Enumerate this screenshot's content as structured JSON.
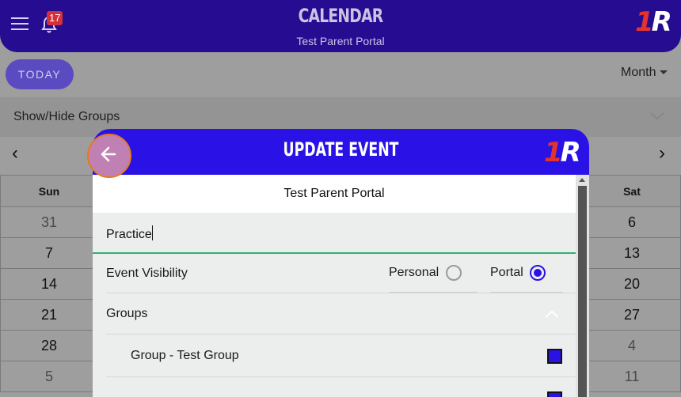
{
  "header": {
    "title": "CALENDAR",
    "subtitle": "Test Parent Portal",
    "notification_count": "17",
    "logo": "1R"
  },
  "toolbar": {
    "today_label": "TODAY",
    "view_label": "Month"
  },
  "groups_bar": {
    "label": "Show/Hide Groups"
  },
  "calendar": {
    "days": [
      "Sun",
      "Sat"
    ],
    "weeks": [
      [
        "31",
        "6"
      ],
      [
        "7",
        "13"
      ],
      [
        "14",
        "20"
      ],
      [
        "21",
        "27"
      ],
      [
        "28",
        "4"
      ],
      [
        "5",
        "11"
      ]
    ]
  },
  "modal": {
    "title": "UPDATE EVENT",
    "logo": "1R",
    "portal_name": "Test Parent Portal",
    "event_title_value": "Practice",
    "visibility_label": "Event Visibility",
    "visibility_options": [
      "Personal",
      "Portal"
    ],
    "selected_visibility": "Portal",
    "groups_label": "Groups",
    "group_items": [
      {
        "label": "Group - Test Group",
        "checked": true
      }
    ]
  },
  "colors": {
    "header": "#260c91",
    "modal_header": "#2a12e6",
    "accent_green": "#2fb26b",
    "badge": "#d3303a"
  }
}
